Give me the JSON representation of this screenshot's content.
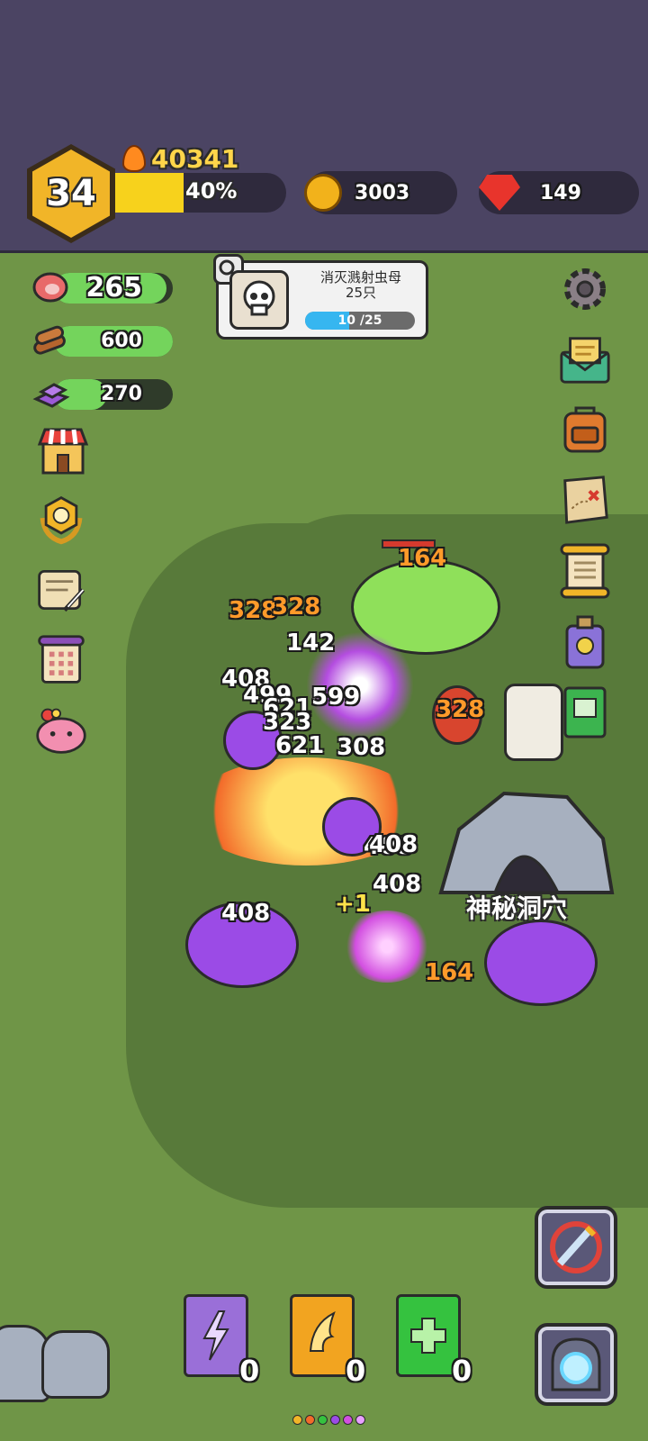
{
  "hud": {
    "level": "34",
    "power": "40341",
    "xp_fraction": 0.4,
    "xp_percent": "40%",
    "coins": "3003",
    "gems": "149"
  },
  "resources": [
    {
      "name": "meat",
      "value": "265",
      "fill": 0.95
    },
    {
      "name": "wood",
      "value": "600",
      "fill": 1.0
    },
    {
      "name": "crystal",
      "value": "270",
      "fill": 0.45
    }
  ],
  "quest": {
    "title": "消灭溅射虫母",
    "subtitle": "25只",
    "current": 10,
    "total": 25,
    "progress_text": "10 /25"
  },
  "damage_numbers": [
    {
      "text": "164",
      "color": "orange"
    },
    {
      "text": "328",
      "color": "orange"
    },
    {
      "text": "328",
      "color": "orange"
    },
    {
      "text": "142",
      "color": "white"
    },
    {
      "text": "408",
      "color": "white"
    },
    {
      "text": "499",
      "color": "white"
    },
    {
      "text": "621",
      "color": "white"
    },
    {
      "text": "599",
      "color": "white"
    },
    {
      "text": "323",
      "color": "white"
    },
    {
      "text": "621",
      "color": "white"
    },
    {
      "text": "308",
      "color": "white"
    },
    {
      "text": "328",
      "color": "orange"
    },
    {
      "text": "408",
      "color": "white"
    },
    {
      "text": "408",
      "color": "white"
    },
    {
      "text": "408",
      "color": "white"
    },
    {
      "text": "408",
      "color": "white"
    },
    {
      "text": "164",
      "color": "orange"
    },
    {
      "text": "+1",
      "color": "yellow"
    }
  ],
  "cave_label": "神秘洞穴",
  "skill_books": [
    {
      "name": "lightning-book",
      "count": "0",
      "color": "#9a6fd8"
    },
    {
      "name": "wing-book",
      "count": "0",
      "color": "#f2a420"
    },
    {
      "name": "heal-book",
      "count": "0",
      "color": "#35c23f"
    }
  ],
  "colors": {
    "accent_gold": "#f1b528",
    "xp_fill": "#f7d21c",
    "grass": "#6f9547",
    "topbar": "#4b4463"
  }
}
